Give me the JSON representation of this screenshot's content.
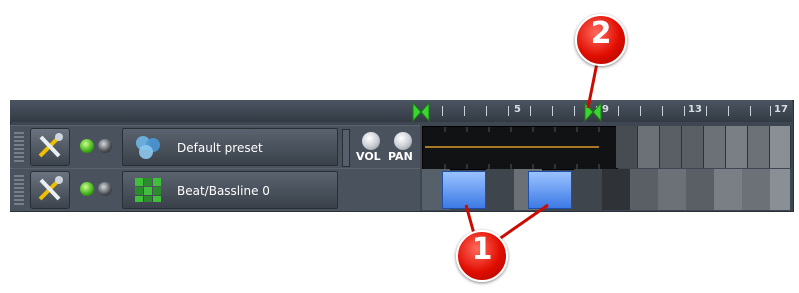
{
  "timeline": {
    "bar_labels": [
      "5",
      "9",
      "13",
      "17"
    ],
    "loop_start_color": "#38d830",
    "loop_end_color": "#38d830"
  },
  "tracks": [
    {
      "name": "Default preset",
      "icon": "tripleoscillator-icon",
      "knobs": [
        "VOL",
        "PAN"
      ]
    },
    {
      "name": "Beat/Bassline 0",
      "icon": "beat-bassline-icon"
    }
  ],
  "callouts": [
    "1",
    "2"
  ],
  "colors": {
    "background": "#3e4651",
    "bb_clip": "#5b8ff2",
    "callout": "#e3100a",
    "clip_line": "#d99a2b"
  }
}
